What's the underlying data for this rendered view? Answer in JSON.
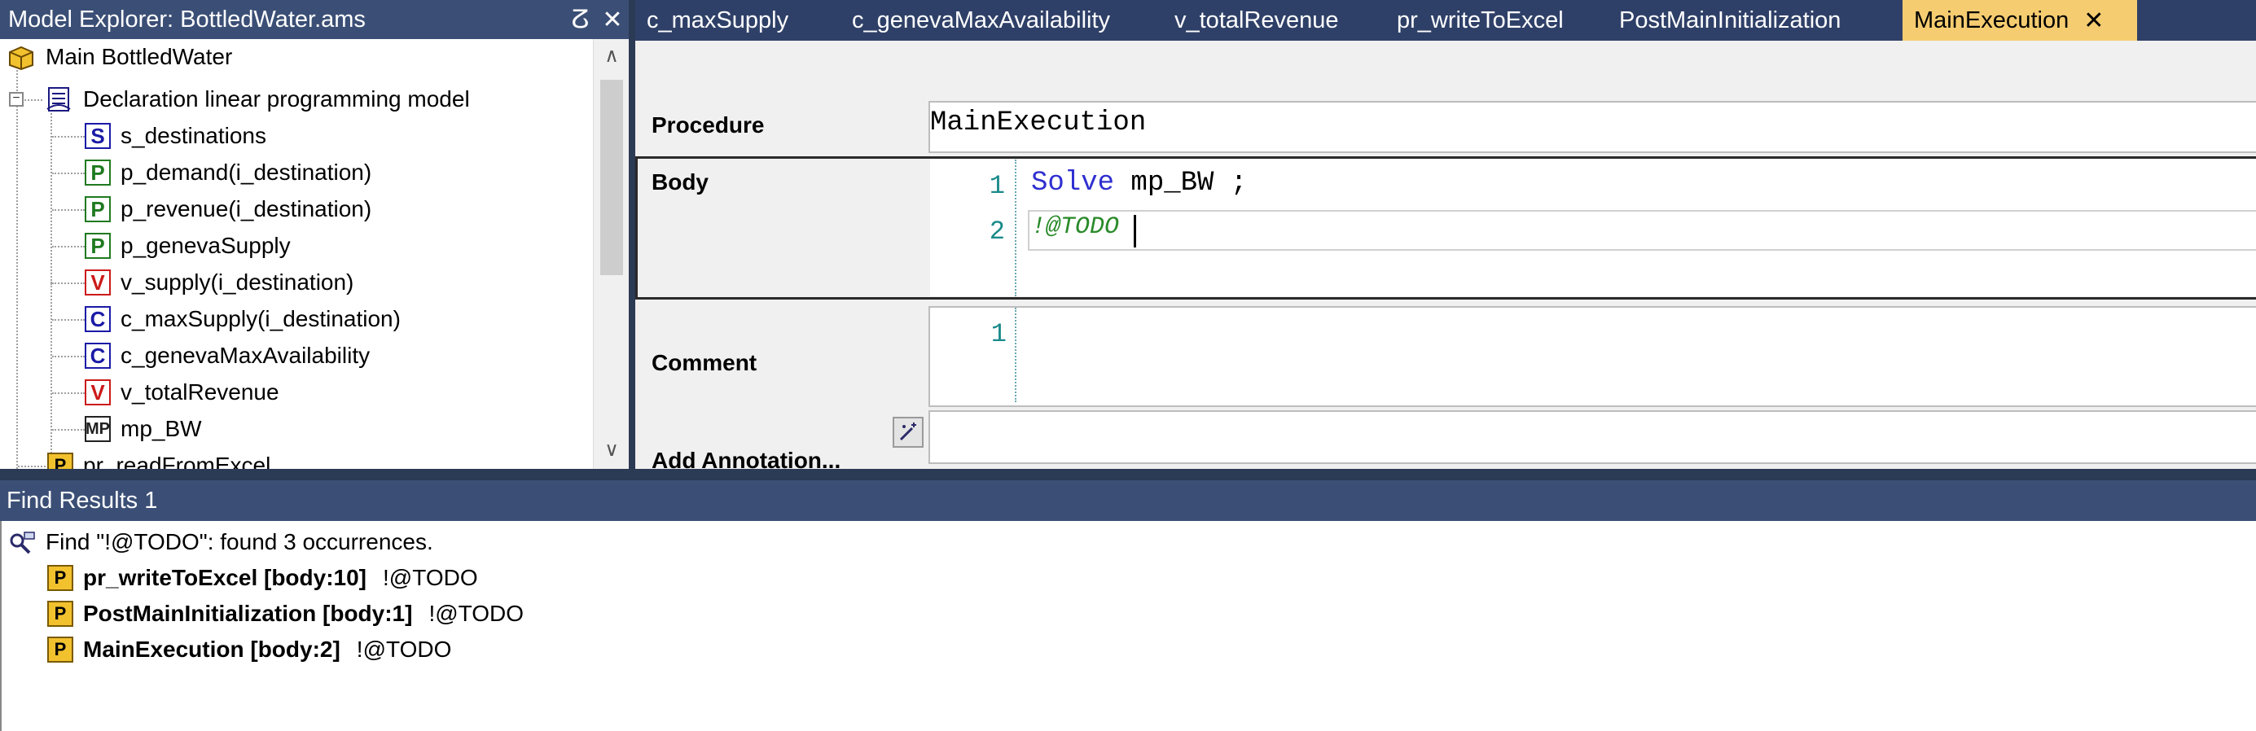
{
  "explorer": {
    "title": "Model Explorer: BottledWater.ams",
    "pin_glyph": "ⵒ",
    "close_glyph": "✕",
    "scroll_up_glyph": "∧",
    "scroll_down_glyph": "∨",
    "items": [
      {
        "label": "Main BottledWater",
        "icon": "main-model-icon"
      },
      {
        "label": "Declaration linear programming model",
        "icon": "declaration-section-icon",
        "expander": "−"
      },
      {
        "label": "s_destinations",
        "icon": "set-icon",
        "glyph": "S"
      },
      {
        "label": "p_demand(i_destination)",
        "icon": "parameter-icon",
        "glyph": "P"
      },
      {
        "label": "p_revenue(i_destination)",
        "icon": "parameter-icon",
        "glyph": "P"
      },
      {
        "label": "p_genevaSupply",
        "icon": "parameter-icon",
        "glyph": "P"
      },
      {
        "label": "v_supply(i_destination)",
        "icon": "variable-icon",
        "glyph": "V"
      },
      {
        "label": "c_maxSupply(i_destination)",
        "icon": "constraint-icon",
        "glyph": "C"
      },
      {
        "label": "c_genevaMaxAvailability",
        "icon": "constraint-icon",
        "glyph": "C"
      },
      {
        "label": "v_totalRevenue",
        "icon": "variable-icon",
        "glyph": "V"
      },
      {
        "label": "mp_BW",
        "icon": "math-program-icon",
        "glyph": "MP"
      },
      {
        "label": "pr_readFromExcel",
        "icon": "procedure-icon",
        "glyph": "P"
      }
    ]
  },
  "tabs": [
    {
      "label": "c_maxSupply"
    },
    {
      "label": "c_genevaMaxAvailability"
    },
    {
      "label": "v_totalRevenue"
    },
    {
      "label": "pr_writeToExcel"
    },
    {
      "label": "PostMainInitialization"
    },
    {
      "label": "MainExecution",
      "active": true,
      "close_glyph": "✕"
    }
  ],
  "editor": {
    "procedure_label": "Procedure",
    "procedure_name": "MainExecution",
    "body_label": "Body",
    "body_lines": [
      {
        "num": "1",
        "keyword": "Solve",
        "rest": " mp_BW ;"
      },
      {
        "num": "2",
        "comment": "!@TODO"
      }
    ],
    "comment_label": "Comment",
    "comment_line_num": "1",
    "add_annotation_label": "Add Annotation..."
  },
  "find": {
    "title": "Find Results 1",
    "summary": "Find \"!@TODO\": found 3 occurrences.",
    "results": [
      {
        "location": "pr_writeToExcel [body:10]",
        "match": "!@TODO"
      },
      {
        "location": "PostMainInitialization [body:1]",
        "match": "!@TODO"
      },
      {
        "location": "MainExecution [body:2]",
        "match": "!@TODO"
      }
    ]
  },
  "colors": {
    "title_bar": "#3b4f76",
    "active_tab": "#f5cc70",
    "keyword_blue": "#2f2fd0",
    "comment_green": "#2a8a2a"
  }
}
